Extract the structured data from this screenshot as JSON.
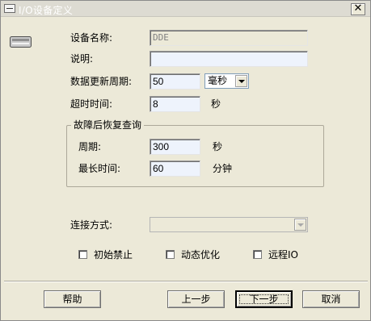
{
  "window": {
    "title": "I/O设备定义"
  },
  "icons": {
    "title": "window-icon",
    "close": "close-icon",
    "device": "device-icon",
    "combo_arrow": "chevron-down-icon"
  },
  "form": {
    "device_name_label": "设备名称:",
    "device_name_value": "DDE",
    "description_label": "说明:",
    "description_value": "",
    "update_period_label": "数据更新周期:",
    "update_period_value": "50",
    "update_period_unit": "毫秒",
    "timeout_label": "超时时间:",
    "timeout_value": "8",
    "timeout_unit": "秒"
  },
  "recovery": {
    "title": "故障后恢复查询",
    "period_label": "周期:",
    "period_value": "300",
    "period_unit": "秒",
    "max_time_label": "最长时间:",
    "max_time_value": "60",
    "max_time_unit": "分钟"
  },
  "connection": {
    "label": "连接方式:",
    "value": ""
  },
  "options": [
    {
      "label": "初始禁止",
      "checked": false
    },
    {
      "label": "动态优化",
      "checked": false
    },
    {
      "label": "远程IO",
      "checked": false
    }
  ],
  "buttons": {
    "help": "帮助",
    "prev": "上一步",
    "next": "下一步",
    "cancel": "取消"
  }
}
